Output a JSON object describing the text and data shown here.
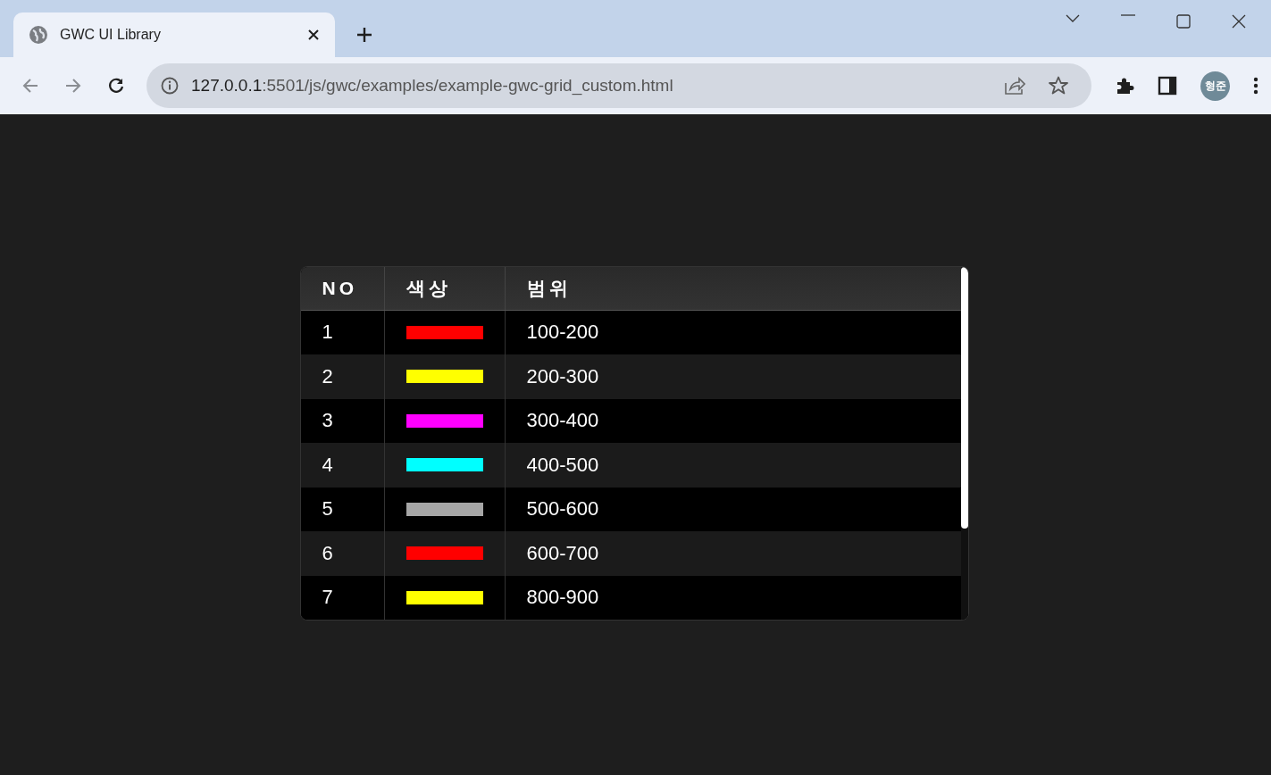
{
  "browser": {
    "tab": {
      "title": "GWC UI Library",
      "selected": true
    },
    "address": {
      "host": "127.0.0.1",
      "path": ":5501/js/gwc/examples/example-gwc-grid_custom.html"
    },
    "profile": "형준"
  },
  "grid": {
    "columns": [
      "NO",
      "색상",
      "범위"
    ],
    "rows": [
      {
        "no": "1",
        "color": "#ff0000",
        "range": "100-200"
      },
      {
        "no": "2",
        "color": "#ffff00",
        "range": "200-300"
      },
      {
        "no": "3",
        "color": "#ff00ff",
        "range": "300-400"
      },
      {
        "no": "4",
        "color": "#00ffff",
        "range": "400-500"
      },
      {
        "no": "5",
        "color": "#a6a6a6",
        "range": "500-600"
      },
      {
        "no": "6",
        "color": "#ff0000",
        "range": "600-700"
      },
      {
        "no": "7",
        "color": "#ffff00",
        "range": "800-900"
      }
    ]
  }
}
